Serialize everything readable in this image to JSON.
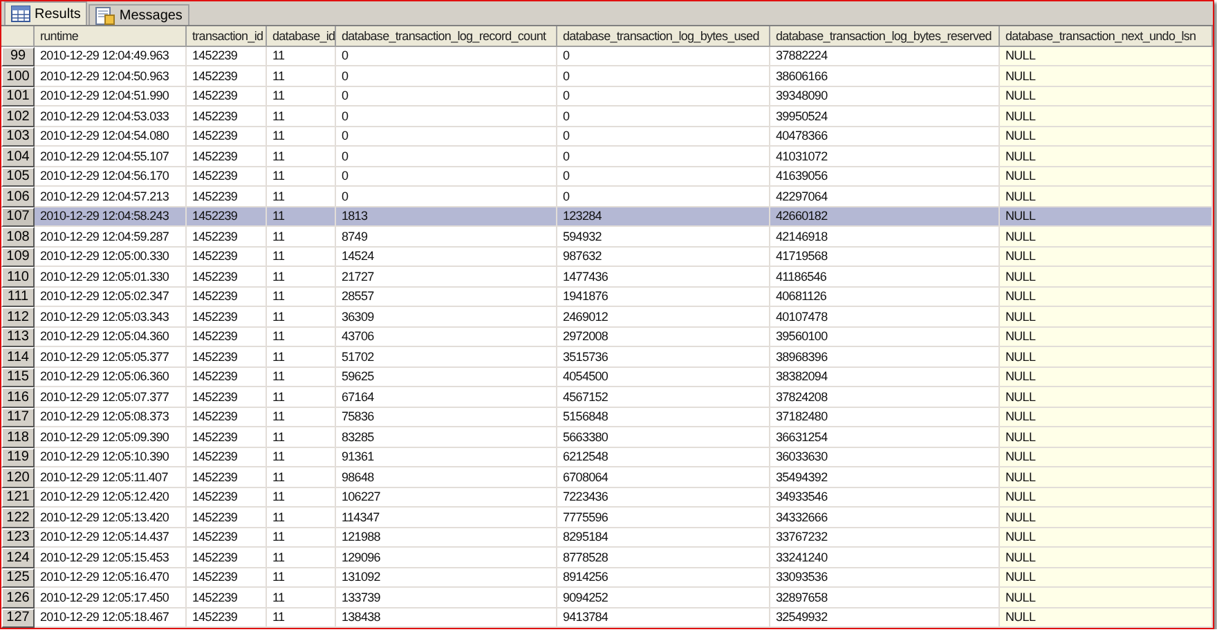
{
  "tabs": [
    {
      "label": "Results",
      "kind": "grid",
      "selected": true
    },
    {
      "label": "Messages",
      "kind": "messages",
      "selected": false
    }
  ],
  "columns": [
    {
      "label": "runtime",
      "shaded": false
    },
    {
      "label": "transaction_id",
      "shaded": false
    },
    {
      "label": "database_id",
      "shaded": false
    },
    {
      "label": "database_transaction_log_record_count",
      "shaded": false
    },
    {
      "label": "database_transaction_log_bytes_used",
      "shaded": false
    },
    {
      "label": "database_transaction_log_bytes_reserved",
      "shaded": false
    },
    {
      "label": "database_transaction_next_undo_lsn",
      "shaded": true
    }
  ],
  "rows": [
    {
      "number": "99",
      "selected": false,
      "cells": [
        "2010-12-29 12:04:49.963",
        "1452239",
        "11",
        "0",
        "0",
        "37882224",
        "NULL"
      ]
    },
    {
      "number": "100",
      "selected": false,
      "cells": [
        "2010-12-29 12:04:50.963",
        "1452239",
        "11",
        "0",
        "0",
        "38606166",
        "NULL"
      ]
    },
    {
      "number": "101",
      "selected": false,
      "cells": [
        "2010-12-29 12:04:51.990",
        "1452239",
        "11",
        "0",
        "0",
        "39348090",
        "NULL"
      ]
    },
    {
      "number": "102",
      "selected": false,
      "cells": [
        "2010-12-29 12:04:53.033",
        "1452239",
        "11",
        "0",
        "0",
        "39950524",
        "NULL"
      ]
    },
    {
      "number": "103",
      "selected": false,
      "cells": [
        "2010-12-29 12:04:54.080",
        "1452239",
        "11",
        "0",
        "0",
        "40478366",
        "NULL"
      ]
    },
    {
      "number": "104",
      "selected": false,
      "cells": [
        "2010-12-29 12:04:55.107",
        "1452239",
        "11",
        "0",
        "0",
        "41031072",
        "NULL"
      ]
    },
    {
      "number": "105",
      "selected": false,
      "cells": [
        "2010-12-29 12:04:56.170",
        "1452239",
        "11",
        "0",
        "0",
        "41639056",
        "NULL"
      ]
    },
    {
      "number": "106",
      "selected": false,
      "cells": [
        "2010-12-29 12:04:57.213",
        "1452239",
        "11",
        "0",
        "0",
        "42297064",
        "NULL"
      ]
    },
    {
      "number": "107",
      "selected": true,
      "cells": [
        "2010-12-29 12:04:58.243",
        "1452239",
        "11",
        "1813",
        "123284",
        "42660182",
        "NULL"
      ]
    },
    {
      "number": "108",
      "selected": false,
      "cells": [
        "2010-12-29 12:04:59.287",
        "1452239",
        "11",
        "8749",
        "594932",
        "42146918",
        "NULL"
      ]
    },
    {
      "number": "109",
      "selected": false,
      "cells": [
        "2010-12-29 12:05:00.330",
        "1452239",
        "11",
        "14524",
        "987632",
        "41719568",
        "NULL"
      ]
    },
    {
      "number": "110",
      "selected": false,
      "cells": [
        "2010-12-29 12:05:01.330",
        "1452239",
        "11",
        "21727",
        "1477436",
        "41186546",
        "NULL"
      ]
    },
    {
      "number": "111",
      "selected": false,
      "cells": [
        "2010-12-29 12:05:02.347",
        "1452239",
        "11",
        "28557",
        "1941876",
        "40681126",
        "NULL"
      ]
    },
    {
      "number": "112",
      "selected": false,
      "cells": [
        "2010-12-29 12:05:03.343",
        "1452239",
        "11",
        "36309",
        "2469012",
        "40107478",
        "NULL"
      ]
    },
    {
      "number": "113",
      "selected": false,
      "cells": [
        "2010-12-29 12:05:04.360",
        "1452239",
        "11",
        "43706",
        "2972008",
        "39560100",
        "NULL"
      ]
    },
    {
      "number": "114",
      "selected": false,
      "cells": [
        "2010-12-29 12:05:05.377",
        "1452239",
        "11",
        "51702",
        "3515736",
        "38968396",
        "NULL"
      ]
    },
    {
      "number": "115",
      "selected": false,
      "cells": [
        "2010-12-29 12:05:06.360",
        "1452239",
        "11",
        "59625",
        "4054500",
        "38382094",
        "NULL"
      ]
    },
    {
      "number": "116",
      "selected": false,
      "cells": [
        "2010-12-29 12:05:07.377",
        "1452239",
        "11",
        "67164",
        "4567152",
        "37824208",
        "NULL"
      ]
    },
    {
      "number": "117",
      "selected": false,
      "cells": [
        "2010-12-29 12:05:08.373",
        "1452239",
        "11",
        "75836",
        "5156848",
        "37182480",
        "NULL"
      ]
    },
    {
      "number": "118",
      "selected": false,
      "cells": [
        "2010-12-29 12:05:09.390",
        "1452239",
        "11",
        "83285",
        "5663380",
        "36631254",
        "NULL"
      ]
    },
    {
      "number": "119",
      "selected": false,
      "cells": [
        "2010-12-29 12:05:10.390",
        "1452239",
        "11",
        "91361",
        "6212548",
        "36033630",
        "NULL"
      ]
    },
    {
      "number": "120",
      "selected": false,
      "cells": [
        "2010-12-29 12:05:11.407",
        "1452239",
        "11",
        "98648",
        "6708064",
        "35494392",
        "NULL"
      ]
    },
    {
      "number": "121",
      "selected": false,
      "cells": [
        "2010-12-29 12:05:12.420",
        "1452239",
        "11",
        "106227",
        "7223436",
        "34933546",
        "NULL"
      ]
    },
    {
      "number": "122",
      "selected": false,
      "cells": [
        "2010-12-29 12:05:13.420",
        "1452239",
        "11",
        "114347",
        "7775596",
        "34332666",
        "NULL"
      ]
    },
    {
      "number": "123",
      "selected": false,
      "cells": [
        "2010-12-29 12:05:14.437",
        "1452239",
        "11",
        "121988",
        "8295184",
        "33767232",
        "NULL"
      ]
    },
    {
      "number": "124",
      "selected": false,
      "cells": [
        "2010-12-29 12:05:15.453",
        "1452239",
        "11",
        "129096",
        "8778528",
        "33241240",
        "NULL"
      ]
    },
    {
      "number": "125",
      "selected": false,
      "cells": [
        "2010-12-29 12:05:16.470",
        "1452239",
        "11",
        "131092",
        "8914256",
        "33093536",
        "NULL"
      ]
    },
    {
      "number": "126",
      "selected": false,
      "cells": [
        "2010-12-29 12:05:17.450",
        "1452239",
        "11",
        "133739",
        "9094252",
        "32897658",
        "NULL"
      ]
    },
    {
      "number": "127",
      "selected": false,
      "cells": [
        "2010-12-29 12:05:18.467",
        "1452239",
        "11",
        "138438",
        "9413784",
        "32549932",
        "NULL"
      ]
    }
  ]
}
